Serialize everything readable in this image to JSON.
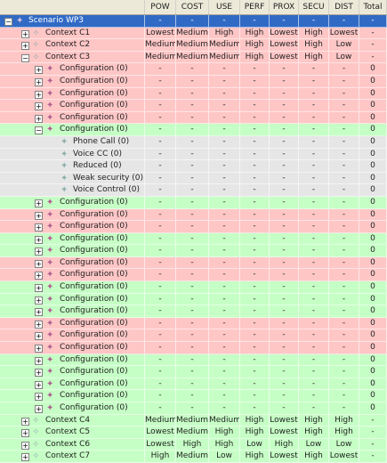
{
  "columns": [
    "",
    "POW",
    "COST",
    "USE",
    "PERF",
    "PROX",
    "SECU",
    "DIST",
    "Total"
  ],
  "rows": [
    {
      "level": 0,
      "label": "Scenario WP3",
      "expander": "minus",
      "icon": "scenario-icon",
      "color": "sel",
      "values": [
        "-",
        "-",
        "-",
        "-",
        "-",
        "-",
        "-",
        "-"
      ]
    },
    {
      "level": 1,
      "label": "Context C1",
      "expander": "plus",
      "icon": "context-icon",
      "color": "red",
      "values": [
        "Lowest",
        "Medium",
        "High",
        "High",
        "Lowest",
        "High",
        "Lowest",
        "-"
      ]
    },
    {
      "level": 1,
      "label": "Context C2",
      "expander": "plus",
      "icon": "context-icon",
      "color": "red",
      "values": [
        "Medium",
        "Medium",
        "Medium",
        "High",
        "Lowest",
        "High",
        "Low",
        "-"
      ]
    },
    {
      "level": 1,
      "label": "Context C3",
      "expander": "minus",
      "icon": "context-icon",
      "color": "red",
      "values": [
        "Medium",
        "Medium",
        "Medium",
        "High",
        "Lowest",
        "High",
        "Low",
        "-"
      ]
    },
    {
      "level": 2,
      "label": "Configuration (0)",
      "expander": "plus",
      "icon": "configuration-icon",
      "color": "red",
      "values": [
        "-",
        "-",
        "-",
        "-",
        "-",
        "-",
        "-",
        "0"
      ]
    },
    {
      "level": 2,
      "label": "Configuration (0)",
      "expander": "plus",
      "icon": "configuration-icon",
      "color": "red",
      "values": [
        "-",
        "-",
        "-",
        "-",
        "-",
        "-",
        "-",
        "0"
      ]
    },
    {
      "level": 2,
      "label": "Configuration (0)",
      "expander": "plus",
      "icon": "configuration-icon",
      "color": "red",
      "values": [
        "-",
        "-",
        "-",
        "-",
        "-",
        "-",
        "-",
        "0"
      ]
    },
    {
      "level": 2,
      "label": "Configuration (0)",
      "expander": "plus",
      "icon": "configuration-icon",
      "color": "red",
      "values": [
        "-",
        "-",
        "-",
        "-",
        "-",
        "-",
        "-",
        "0"
      ]
    },
    {
      "level": 2,
      "label": "Configuration (0)",
      "expander": "plus",
      "icon": "configuration-icon",
      "color": "red",
      "values": [
        "-",
        "-",
        "-",
        "-",
        "-",
        "-",
        "-",
        "0"
      ]
    },
    {
      "level": 2,
      "label": "Configuration (0)",
      "expander": "minus",
      "icon": "configuration-icon",
      "color": "green",
      "values": [
        "-",
        "-",
        "-",
        "-",
        "-",
        "-",
        "-",
        "0"
      ]
    },
    {
      "level": 3,
      "label": "Phone Call (0)",
      "expander": "",
      "icon": "component-icon",
      "color": "gray",
      "values": [
        "-",
        "-",
        "-",
        "-",
        "-",
        "-",
        "-",
        "0"
      ]
    },
    {
      "level": 3,
      "label": "Voice CC (0)",
      "expander": "",
      "icon": "component-icon",
      "color": "gray",
      "values": [
        "-",
        "-",
        "-",
        "-",
        "-",
        "-",
        "-",
        "0"
      ]
    },
    {
      "level": 3,
      "label": "Reduced (0)",
      "expander": "",
      "icon": "component-icon",
      "color": "gray",
      "values": [
        "-",
        "-",
        "-",
        "-",
        "-",
        "-",
        "-",
        "0"
      ]
    },
    {
      "level": 3,
      "label": "Weak security (0)",
      "expander": "",
      "icon": "component-icon",
      "color": "gray",
      "values": [
        "-",
        "-",
        "-",
        "-",
        "-",
        "-",
        "-",
        "0"
      ]
    },
    {
      "level": 3,
      "label": "Voice Control (0)",
      "expander": "",
      "icon": "component-icon",
      "color": "gray",
      "values": [
        "-",
        "-",
        "-",
        "-",
        "-",
        "-",
        "-",
        "0"
      ]
    },
    {
      "level": 2,
      "label": "Configuration (0)",
      "expander": "plus",
      "icon": "configuration-icon",
      "color": "green",
      "values": [
        "-",
        "-",
        "-",
        "-",
        "-",
        "-",
        "-",
        "0"
      ]
    },
    {
      "level": 2,
      "label": "Configuration (0)",
      "expander": "plus",
      "icon": "configuration-icon",
      "color": "red",
      "values": [
        "-",
        "-",
        "-",
        "-",
        "-",
        "-",
        "-",
        "0"
      ]
    },
    {
      "level": 2,
      "label": "Configuration (0)",
      "expander": "plus",
      "icon": "configuration-icon",
      "color": "red",
      "values": [
        "-",
        "-",
        "-",
        "-",
        "-",
        "-",
        "-",
        "0"
      ]
    },
    {
      "level": 2,
      "label": "Configuration (0)",
      "expander": "plus",
      "icon": "configuration-icon",
      "color": "green",
      "values": [
        "-",
        "-",
        "-",
        "-",
        "-",
        "-",
        "-",
        "0"
      ]
    },
    {
      "level": 2,
      "label": "Configuration (0)",
      "expander": "plus",
      "icon": "configuration-icon",
      "color": "green",
      "values": [
        "-",
        "-",
        "-",
        "-",
        "-",
        "-",
        "-",
        "0"
      ]
    },
    {
      "level": 2,
      "label": "Configuration (0)",
      "expander": "plus",
      "icon": "configuration-icon",
      "color": "red",
      "values": [
        "-",
        "-",
        "-",
        "-",
        "-",
        "-",
        "-",
        "0"
      ]
    },
    {
      "level": 2,
      "label": "Configuration (0)",
      "expander": "plus",
      "icon": "configuration-icon",
      "color": "red",
      "values": [
        "-",
        "-",
        "-",
        "-",
        "-",
        "-",
        "-",
        "0"
      ]
    },
    {
      "level": 2,
      "label": "Configuration (0)",
      "expander": "plus",
      "icon": "configuration-icon",
      "color": "green",
      "values": [
        "-",
        "-",
        "-",
        "-",
        "-",
        "-",
        "-",
        "0"
      ]
    },
    {
      "level": 2,
      "label": "Configuration (0)",
      "expander": "plus",
      "icon": "configuration-icon",
      "color": "green",
      "values": [
        "-",
        "-",
        "-",
        "-",
        "-",
        "-",
        "-",
        "0"
      ]
    },
    {
      "level": 2,
      "label": "Configuration (0)",
      "expander": "plus",
      "icon": "configuration-icon",
      "color": "green",
      "values": [
        "-",
        "-",
        "-",
        "-",
        "-",
        "-",
        "-",
        "0"
      ]
    },
    {
      "level": 2,
      "label": "Configuration (0)",
      "expander": "plus",
      "icon": "configuration-icon",
      "color": "red",
      "values": [
        "-",
        "-",
        "-",
        "-",
        "-",
        "-",
        "-",
        "0"
      ]
    },
    {
      "level": 2,
      "label": "Configuration (0)",
      "expander": "plus",
      "icon": "configuration-icon",
      "color": "red",
      "values": [
        "-",
        "-",
        "-",
        "-",
        "-",
        "-",
        "-",
        "0"
      ]
    },
    {
      "level": 2,
      "label": "Configuration (0)",
      "expander": "plus",
      "icon": "configuration-icon",
      "color": "red",
      "values": [
        "-",
        "-",
        "-",
        "-",
        "-",
        "-",
        "-",
        "0"
      ]
    },
    {
      "level": 2,
      "label": "Configuration (0)",
      "expander": "plus",
      "icon": "configuration-icon",
      "color": "green",
      "values": [
        "-",
        "-",
        "-",
        "-",
        "-",
        "-",
        "-",
        "0"
      ]
    },
    {
      "level": 2,
      "label": "Configuration (0)",
      "expander": "plus",
      "icon": "configuration-icon",
      "color": "green",
      "values": [
        "-",
        "-",
        "-",
        "-",
        "-",
        "-",
        "-",
        "0"
      ]
    },
    {
      "level": 2,
      "label": "Configuration (0)",
      "expander": "plus",
      "icon": "configuration-icon",
      "color": "green",
      "values": [
        "-",
        "-",
        "-",
        "-",
        "-",
        "-",
        "-",
        "0"
      ]
    },
    {
      "level": 2,
      "label": "Configuration (0)",
      "expander": "plus",
      "icon": "configuration-icon",
      "color": "green",
      "values": [
        "-",
        "-",
        "-",
        "-",
        "-",
        "-",
        "-",
        "0"
      ]
    },
    {
      "level": 2,
      "label": "Configuration (0)",
      "expander": "plus",
      "icon": "configuration-icon",
      "color": "green",
      "values": [
        "-",
        "-",
        "-",
        "-",
        "-",
        "-",
        "-",
        "0"
      ]
    },
    {
      "level": 1,
      "label": "Context C4",
      "expander": "plus",
      "icon": "context-icon",
      "color": "green",
      "values": [
        "Medium",
        "Medium",
        "Medium",
        "High",
        "Lowest",
        "High",
        "High",
        "-"
      ]
    },
    {
      "level": 1,
      "label": "Context C5",
      "expander": "plus",
      "icon": "context-icon",
      "color": "green",
      "values": [
        "Lowest",
        "Medium",
        "High",
        "High",
        "Lowest",
        "High",
        "High",
        "-"
      ]
    },
    {
      "level": 1,
      "label": "Context C6",
      "expander": "plus",
      "icon": "context-icon",
      "color": "green",
      "values": [
        "Lowest",
        "High",
        "High",
        "Low",
        "High",
        "Low",
        "Low",
        "-"
      ]
    },
    {
      "level": 1,
      "label": "Context C7",
      "expander": "plus",
      "icon": "context-icon",
      "color": "green",
      "values": [
        "High",
        "Medium",
        "Low",
        "High",
        "Lowest",
        "High",
        "Lowest",
        "-"
      ]
    }
  ]
}
